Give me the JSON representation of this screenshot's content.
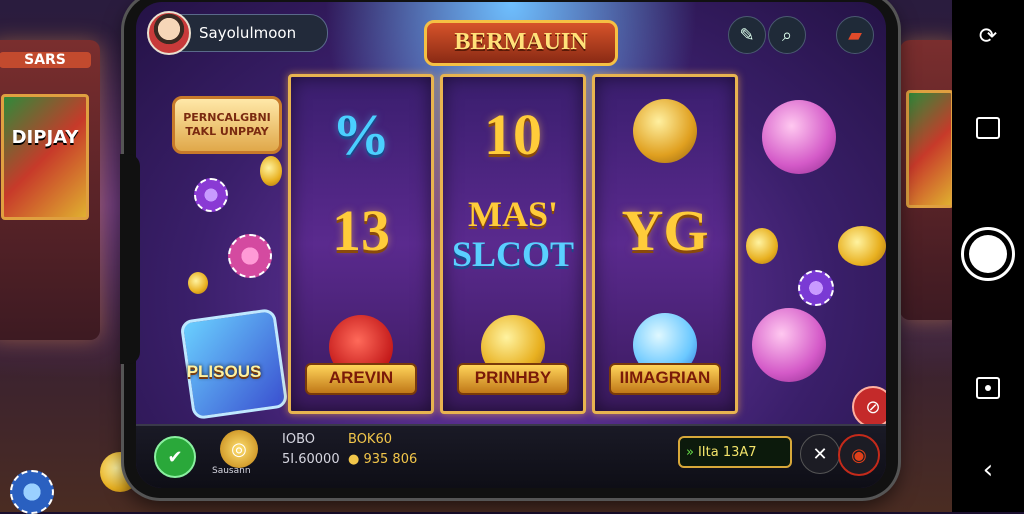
{
  "header": {
    "player_name": "Sayolulmoon",
    "game_title": "BERMAUIN"
  },
  "left_badge": {
    "line1": "PERNCALGBNI",
    "line2": "TAKL UNPPAY"
  },
  "left_deco_label": "PLISOUS",
  "arcade_label": "SARS",
  "arcade_screen_text": "DIPJAY",
  "reels": [
    {
      "top": "%",
      "middle": "13",
      "bottom_plate": "AREVIN"
    },
    {
      "top": "10",
      "middle_line1": "MAS'",
      "middle_line2": "SLCOT",
      "bottom_plate": "PRINHBY"
    },
    {
      "top": "coin",
      "middle": "YG",
      "bottom_plate": "IIMAGRIAN"
    }
  ],
  "bottom_bar": {
    "bet_label": "Sausann",
    "col1_label": "IOBO",
    "col1_value": "5I.60000",
    "col2_label": "BOK60",
    "col2_value": "935 806",
    "win_text": "IIta 13A7"
  },
  "icons": {
    "top_right": [
      "pencil-icon",
      "search-icon",
      "car-icon"
    ],
    "bottom": [
      "check-icon",
      "coin-stack-icon",
      "close-icon",
      "record-icon"
    ],
    "navbar": [
      "camera-switch-icon",
      "square-icon",
      "shutter-button",
      "capture-icon",
      "back-icon"
    ]
  },
  "colors": {
    "gold": "#f2c64a",
    "purple": "#5a2a8e",
    "check_green": "#2aa83a",
    "record_red": "#c42a1a"
  }
}
